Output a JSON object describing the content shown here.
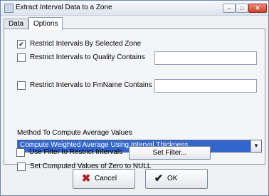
{
  "window": {
    "title": "Extract Interval Data to a Zone"
  },
  "tabs": [
    {
      "label": "Data"
    },
    {
      "label": "Options"
    }
  ],
  "options": {
    "restrict_zone": {
      "label": "Restrict Intervals By Selected Zone",
      "checked": true
    },
    "restrict_quality": {
      "label": "Restrict Intervals to Quality Contains",
      "checked": false,
      "value": ""
    },
    "restrict_fmname": {
      "label": "Restrict Intervals to FmName Contains",
      "checked": false,
      "value": ""
    },
    "method_label": "Method To Compute Average Values",
    "method_selected": "Compute Weighted Average Using Interval Thickness",
    "zero_to_null": {
      "label": "Set Computed Values of Zero to NULL",
      "checked": false
    },
    "use_filter": {
      "label": "Use Filter to Restrict Intervals",
      "checked": false
    },
    "set_filter_label": "Set Filter..."
  },
  "footer": {
    "cancel_label": "Cancel",
    "ok_label": "OK"
  }
}
